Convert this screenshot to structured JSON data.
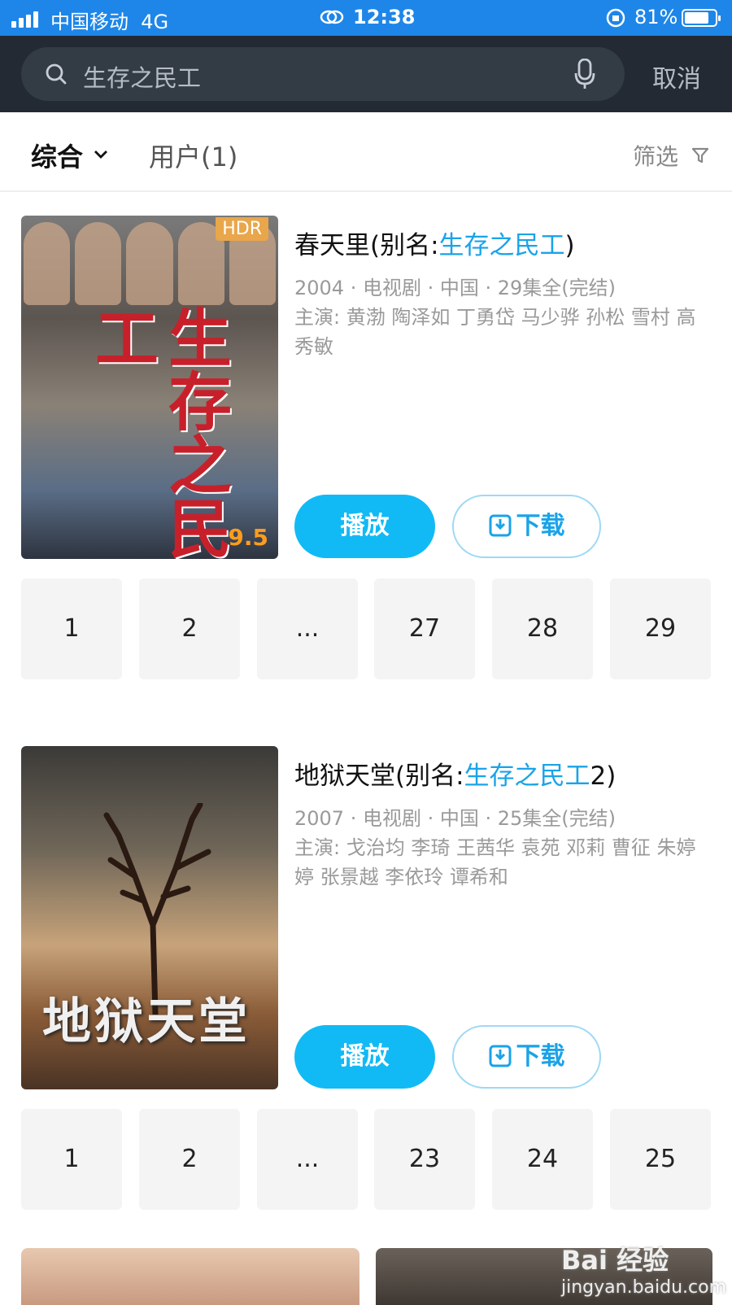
{
  "status_bar": {
    "carrier": "中国移动",
    "network": "4G",
    "time": "12:38",
    "battery_pct_label": "81%",
    "battery_level": 0.81
  },
  "search": {
    "query": "生存之民工",
    "cancel_label": "取消"
  },
  "tabs": {
    "all_label": "综合",
    "user_label": "用户(1)",
    "filter_label": "筛选"
  },
  "results": [
    {
      "title_prefix": "春天里(别名:",
      "title_highlight": "生存之民工",
      "title_suffix": ")",
      "meta": "2004 · 电视剧 · 中国 · 29集全(完结)",
      "cast": "主演: 黄渤 陶泽如 丁勇岱 马少骅 孙松 雪村 高秀敏",
      "poster_badge": "HDR",
      "poster_title": "生存之民工",
      "score": "9.5",
      "play_label": "播放",
      "download_label": "下载",
      "episodes": [
        "1",
        "2",
        "...",
        "27",
        "28",
        "29"
      ]
    },
    {
      "title_prefix": "地狱天堂(别名:",
      "title_highlight": "生存之民工",
      "title_suffix": "2)",
      "meta": "2007 · 电视剧 · 中国 · 25集全(完结)",
      "cast": "主演: 戈治均 李琦 王茜华 袁苑 邓莉 曹征 朱婷婷 张景越 李依玲 谭希和",
      "poster_title": "地狱天堂",
      "play_label": "播放",
      "download_label": "下载",
      "episodes": [
        "1",
        "2",
        "...",
        "23",
        "24",
        "25"
      ]
    }
  ],
  "watermark": {
    "line1": "Bai 经验",
    "line2": "jingyan.baidu.com"
  },
  "colors": {
    "status_bar": "#1e86e8",
    "header": "#232a33",
    "accent": "#11baf5",
    "highlight": "#1aa3e8"
  }
}
